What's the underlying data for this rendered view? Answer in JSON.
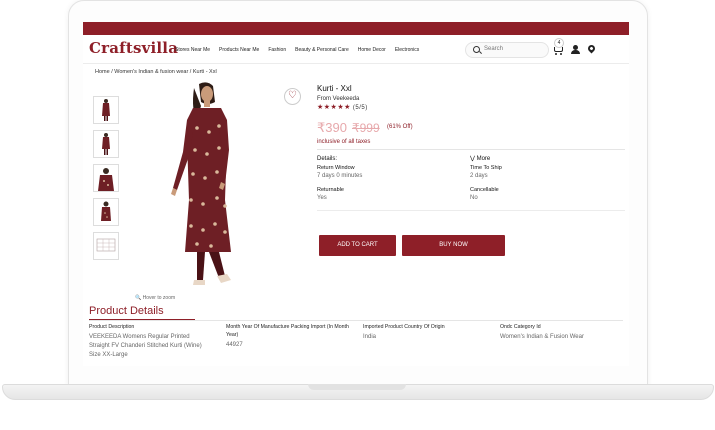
{
  "brand": {
    "logo": "Craftsvilla"
  },
  "nav": {
    "items": [
      "Stores Near Me",
      "Products Near Me",
      "Fashion",
      "Beauty & Personal Care",
      "Home Decor",
      "Electronics"
    ],
    "search_placeholder": "Search",
    "cart_count": "4"
  },
  "breadcrumb": "Home / Women's Indian & fusion wear / Kurti - Xxl",
  "gallery": {
    "hover_text": "Hover to zoom"
  },
  "product": {
    "title": "Kurti - Xxl",
    "seller": "From Veekeeda",
    "stars": "★★★★★",
    "rating_text": "(5/5)",
    "price": "₹390",
    "mrp": "₹999",
    "discount": "(61% Off)",
    "tax_note": "inclusive of all taxes",
    "details_label": "Details:",
    "more_label": "More",
    "details": [
      {
        "label": "Return Window",
        "value": "7 days 0 minutes"
      },
      {
        "label": "Time To Ship",
        "value": "2 days"
      },
      {
        "label": "Returnable",
        "value": "Yes"
      },
      {
        "label": "Cancellable",
        "value": "No"
      }
    ],
    "add_to_cart": "ADD TO CART",
    "buy_now": "BUY NOW"
  },
  "product_details": {
    "title": "Product Details",
    "columns": [
      {
        "label": "Product Description",
        "value": "VEEKEEDA Womens Regular Printed Straight FV Chanderi Stitched Kurti (Wine) Size XX-Large"
      },
      {
        "label": "Month Year Of Manufacture Packing Import (In Month Year)",
        "value": "44927"
      },
      {
        "label": "Imported Product Country Of Origin",
        "value": "India"
      },
      {
        "label": "Ondc Category Id",
        "value": "Women's Indian & Fusion Wear"
      }
    ]
  },
  "colors": {
    "brand": "#8e1f28",
    "price_faded": "#e7a9ac"
  }
}
